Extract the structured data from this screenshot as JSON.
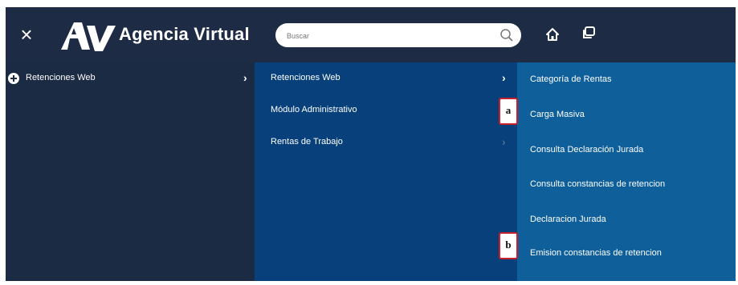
{
  "topbar": {
    "brand": "Agencia Virtual",
    "search_placeholder": "Buscar"
  },
  "menu": {
    "level1": [
      {
        "label": "Retenciones Web"
      }
    ],
    "level2": [
      {
        "label": "Retenciones Web"
      },
      {
        "label": "Módulo Administrativo"
      },
      {
        "label": "Rentas de Trabajo"
      }
    ],
    "level3": [
      {
        "label": "Categoría de Rentas"
      },
      {
        "label": "Carga Masiva"
      },
      {
        "label": "Consulta Declaración Jurada"
      },
      {
        "label": "Consulta constancias de retencion"
      },
      {
        "label": "Declaracion Jurada"
      },
      {
        "label": "Emision constancias de retencion"
      }
    ]
  },
  "callouts": {
    "a": "a",
    "b": "b"
  },
  "colors": {
    "topbar": "#1d2b45",
    "level1_bg": "#1c2b44",
    "level2_bg": "#07407a",
    "level3_bg": "#0e5f9a",
    "callout_border": "#c8202a"
  }
}
